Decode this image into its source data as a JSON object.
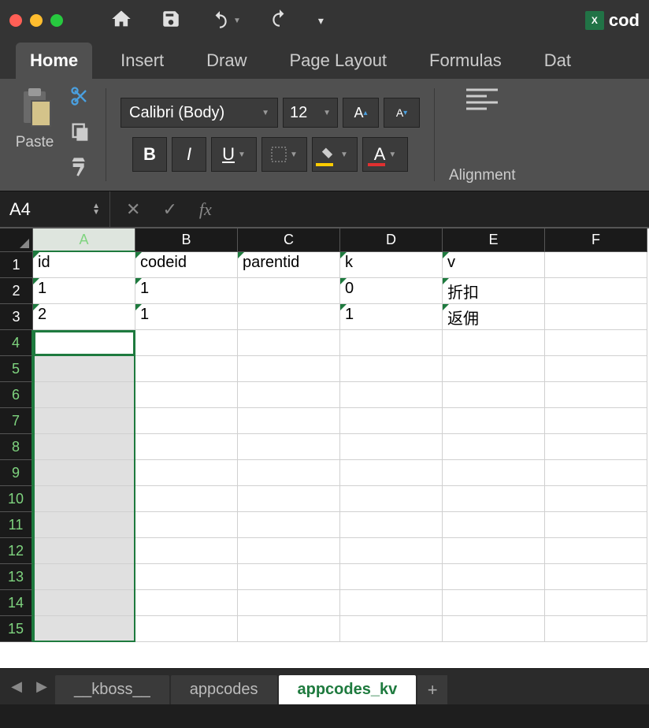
{
  "app": {
    "doc_title": "cod"
  },
  "name_box": "A4",
  "font": {
    "family": "Calibri (Body)",
    "size": "12"
  },
  "ribbon_tabs": [
    "Home",
    "Insert",
    "Draw",
    "Page Layout",
    "Formulas",
    "Dat"
  ],
  "active_ribbon_tab": 0,
  "ribbon_labels": {
    "paste": "Paste",
    "alignment": "Alignment"
  },
  "columns": [
    "A",
    "B",
    "C",
    "D",
    "E",
    "F"
  ],
  "selected_column_index": 0,
  "rows_visible": 15,
  "active_cell_row": 4,
  "chart_data": {
    "type": "table",
    "headers": [
      "id",
      "codeid",
      "parentid",
      "k",
      "v"
    ],
    "rows": [
      [
        "1",
        "1",
        "",
        "0",
        "折扣"
      ],
      [
        "2",
        "1",
        "",
        "1",
        "返佣"
      ]
    ]
  },
  "sheet_tabs": [
    "__kboss__",
    "appcodes",
    "appcodes_kv"
  ],
  "active_sheet_index": 2,
  "formula_bar_value": ""
}
